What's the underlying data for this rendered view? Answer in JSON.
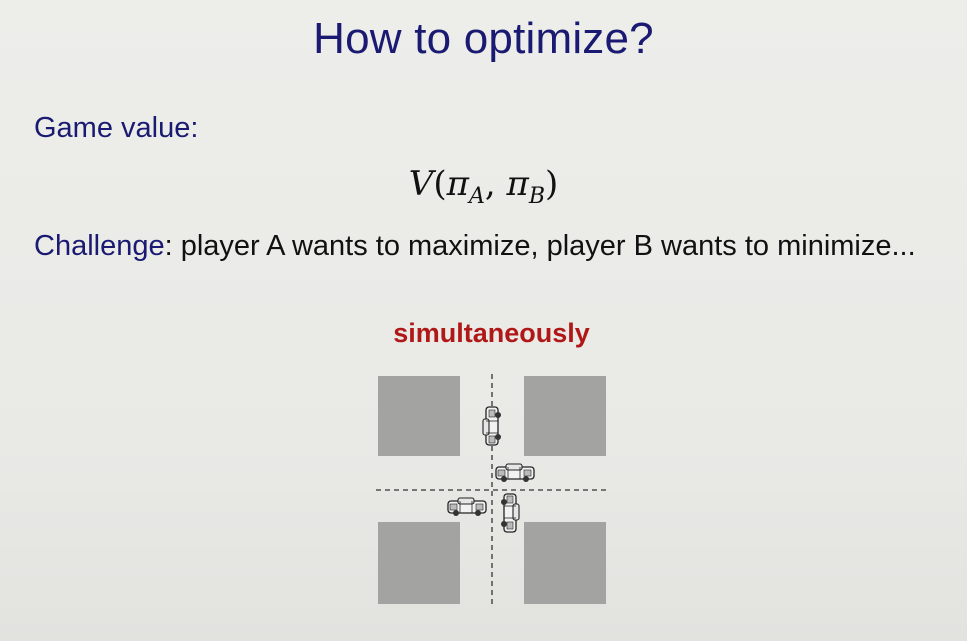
{
  "slide": {
    "title": "How to optimize?",
    "game_value_label": "Game value:",
    "formula": {
      "func": "V",
      "open": "(",
      "arg1": "π",
      "sub1": "A",
      "sep": ", ",
      "arg2": "π",
      "sub2": "B",
      "close": ")"
    },
    "challenge_keyword": "Challenge",
    "challenge_text": ": player A wants to maximize, player B wants to minimize...",
    "emphasis": "simultaneously"
  },
  "colors": {
    "title": "#1a1a72",
    "emphasis": "#b01818",
    "block": "#a3a4a1",
    "background": "#ebebe8"
  },
  "illustration": {
    "type": "four-way intersection",
    "cars": 4
  }
}
